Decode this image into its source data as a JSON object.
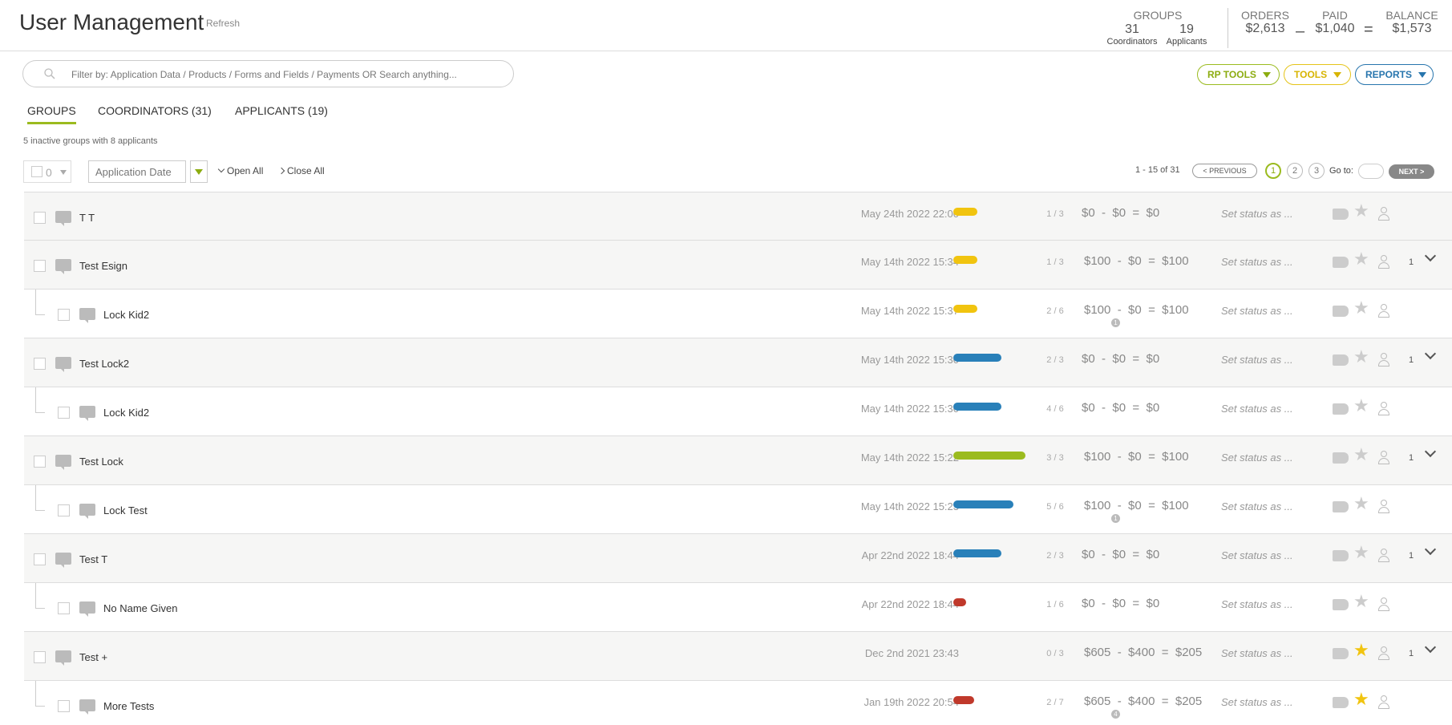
{
  "header": {
    "title": "User Management",
    "refresh": "Refresh",
    "groups": {
      "label": "GROUPS",
      "coordinators_count": "31",
      "coordinators_label": "Coordinators",
      "applicants_count": "19",
      "applicants_label": "Applicants"
    },
    "orders": {
      "label": "ORDERS",
      "value": "$2,613"
    },
    "paid": {
      "label": "PAID",
      "value": "$1,040"
    },
    "balance": {
      "label": "BALANCE",
      "value": "$1,573"
    },
    "minus": "–",
    "equals": "="
  },
  "search": {
    "placeholder": "Filter by: Application Data / Products / Forms and Fields / Payments OR Search anything..."
  },
  "tools": {
    "rp_tools": "RP TOOLS",
    "tools": "TOOLS",
    "reports": "REPORTS"
  },
  "tabs": {
    "groups": "GROUPS",
    "coordinators": "COORDINATORS (31)",
    "applicants": "APPLICANTS (19)"
  },
  "inactive_note": "5 inactive groups with 8 applicants",
  "filter": {
    "selected_count": "0",
    "sort_field": "Application Date",
    "open_all": "Open All",
    "close_all": "Close All"
  },
  "pagination": {
    "info": "1 - 15 of 31",
    "previous": "< PREVIOUS",
    "pages": [
      "1",
      "2",
      "3"
    ],
    "goto": "Go to:",
    "next": "NEXT >"
  },
  "colors": {
    "green": "#9bbb1f",
    "yellow": "#f1c40f",
    "blue": "#2980b9",
    "red": "#c0392b"
  },
  "rows": [
    {
      "type": "group",
      "name": "T T",
      "date": "May 24th 2022 22:00",
      "bar_color": "#f1c40f",
      "bar_fraction": 0.33,
      "ratio": "1 / 3",
      "orders": "$0",
      "paid": "$0",
      "balance": "$0",
      "status": "Set status as ...",
      "starred": false,
      "count": ""
    },
    {
      "type": "group",
      "name": "Test Esign",
      "date": "May 14th 2022 15:34",
      "bar_color": "#f1c40f",
      "bar_fraction": 0.33,
      "ratio": "1 / 3",
      "orders": "$100",
      "paid": "$0",
      "balance": "$100",
      "status": "Set status as ...",
      "starred": false,
      "count": "1"
    },
    {
      "type": "child",
      "name": "Lock Kid2",
      "date": "May 14th 2022 15:37",
      "bar_color": "#f1c40f",
      "bar_fraction": 0.33,
      "ratio": "2 / 6",
      "orders": "$100",
      "paid": "$0",
      "balance": "$100",
      "status": "Set status as ...",
      "starred": false,
      "count": "",
      "badge": "1"
    },
    {
      "type": "group",
      "name": "Test Lock2",
      "date": "May 14th 2022 15:30",
      "bar_color": "#2980b9",
      "bar_fraction": 0.67,
      "ratio": "2 / 3",
      "orders": "$0",
      "paid": "$0",
      "balance": "$0",
      "status": "Set status as ...",
      "starred": false,
      "count": "1"
    },
    {
      "type": "child",
      "name": "Lock Kid2",
      "date": "May 14th 2022 15:30",
      "bar_color": "#2980b9",
      "bar_fraction": 0.67,
      "ratio": "4 / 6",
      "orders": "$0",
      "paid": "$0",
      "balance": "$0",
      "status": "Set status as ...",
      "starred": false,
      "count": ""
    },
    {
      "type": "group",
      "name": "Test Lock",
      "date": "May 14th 2022 15:22",
      "bar_color": "#9bbb1f",
      "bar_fraction": 1.0,
      "ratio": "3 / 3",
      "orders": "$100",
      "paid": "$0",
      "balance": "$100",
      "status": "Set status as ...",
      "starred": false,
      "count": "1"
    },
    {
      "type": "child",
      "name": "Lock Test",
      "date": "May 14th 2022 15:23",
      "bar_color": "#2980b9",
      "bar_fraction": 0.83,
      "ratio": "5 / 6",
      "orders": "$100",
      "paid": "$0",
      "balance": "$100",
      "status": "Set status as ...",
      "starred": false,
      "count": "",
      "badge": "1"
    },
    {
      "type": "group",
      "name": "Test T",
      "date": "Apr 22nd 2022 18:44",
      "bar_color": "#2980b9",
      "bar_fraction": 0.67,
      "ratio": "2 / 3",
      "orders": "$0",
      "paid": "$0",
      "balance": "$0",
      "status": "Set status as ...",
      "starred": false,
      "count": "1"
    },
    {
      "type": "child",
      "name": "No Name Given",
      "date": "Apr 22nd 2022 18:44",
      "bar_color": "#c0392b",
      "bar_fraction": 0.17,
      "ratio": "1 / 6",
      "orders": "$0",
      "paid": "$0",
      "balance": "$0",
      "status": "Set status as ...",
      "starred": false,
      "count": ""
    },
    {
      "type": "group",
      "name": "Test +",
      "date": "Dec 2nd 2021 23:43",
      "bar_color": "",
      "bar_fraction": 0,
      "ratio": "0 / 3",
      "orders": "$605",
      "paid": "$400",
      "balance": "$205",
      "status": "Set status as ...",
      "starred": true,
      "count": "1"
    },
    {
      "type": "child",
      "name": "More Tests",
      "date": "Jan 19th 2022 20:54",
      "bar_color": "#c0392b",
      "bar_fraction": 0.29,
      "ratio": "2 / 7",
      "orders": "$605",
      "paid": "$400",
      "balance": "$205",
      "status": "Set status as ...",
      "starred": true,
      "count": "",
      "badge": "4"
    }
  ]
}
